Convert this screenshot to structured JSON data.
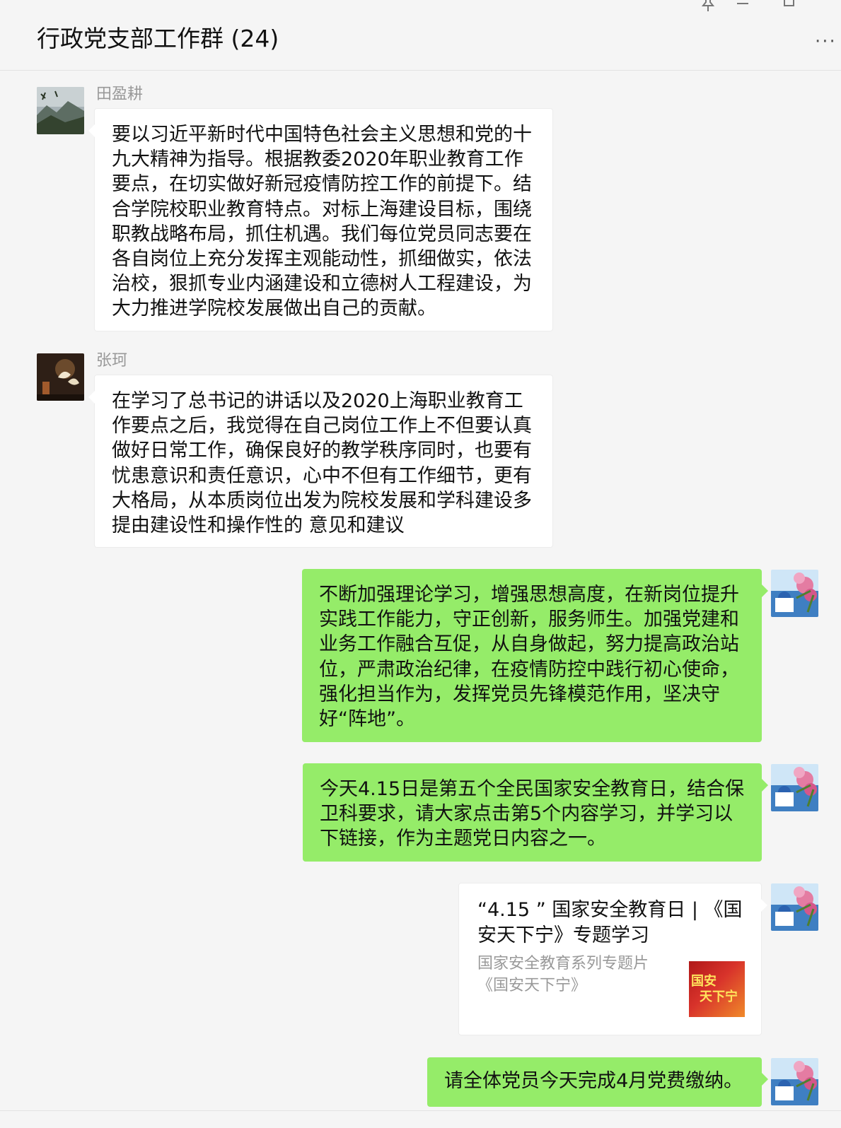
{
  "window": {
    "title": "行政党支部工作群 (24)",
    "more_label": "···",
    "pin_icon": "pin-icon",
    "minimize_icon": "minimize-icon",
    "maximize_icon": "maximize-icon"
  },
  "colors": {
    "outgoing_bubble": "#95ec69",
    "incoming_bubble": "#ffffff",
    "background": "#f5f5f5",
    "sender_name": "#999999"
  },
  "messages": [
    {
      "sender": "田盈耕",
      "direction": "incoming",
      "text": "要以习近平新时代中国特色社会主义思想和党的十九大精神为指导。根据教委2020年职业教育工作要点，在切实做好新冠疫情防控工作的前提下。结合学院校职业教育特点。对标上海建设目标，围绕职教战略布局，抓住机遇。我们每位党员同志要在各自岗位上充分发挥主观能动性，抓细做实，依法治校，狠抓专业内涵建设和立德树人工程建设，为大力推进学院校发展做出自己的贡献。"
    },
    {
      "sender": "张珂",
      "direction": "incoming",
      "text": "在学习了总书记的讲话以及2020上海职业教育工作要点之后，我觉得在自己岗位工作上不但要认真做好日常工作，确保良好的教学秩序同时，也要有忧患意识和责任意识，心中不但有工作细节，更有大格局，从本质岗位出发为院校发展和学科建设多提由建设性和操作性的 意见和建议"
    },
    {
      "direction": "outgoing",
      "text": "不断加强理论学习，增强思想高度，在新岗位提升实践工作能力，守正创新，服务师生。加强党建和业务工作融合互促，从自身做起，努力提高政治站位，严肃政治纪律，在疫情防控中践行初心使命，强化担当作为，发挥党员先锋模范作用，坚决守好“阵地”。"
    },
    {
      "direction": "outgoing",
      "text": "今天4.15日是第五个全民国家安全教育日，结合保卫科要求，请大家点击第5个内容学习，并学习以下链接，作为主题党日内容之一。"
    },
    {
      "direction": "outgoing",
      "type": "link",
      "title": "“4.15 ” 国家安全教育日 | 《国安天下宁》专题学习",
      "description": "国家安全教育系列专题片《国安天下宁》",
      "thumb_line1": "国安",
      "thumb_line2": "天下宁"
    },
    {
      "direction": "outgoing",
      "text": "请全体党员今天完成4月党费缴纳。"
    }
  ]
}
